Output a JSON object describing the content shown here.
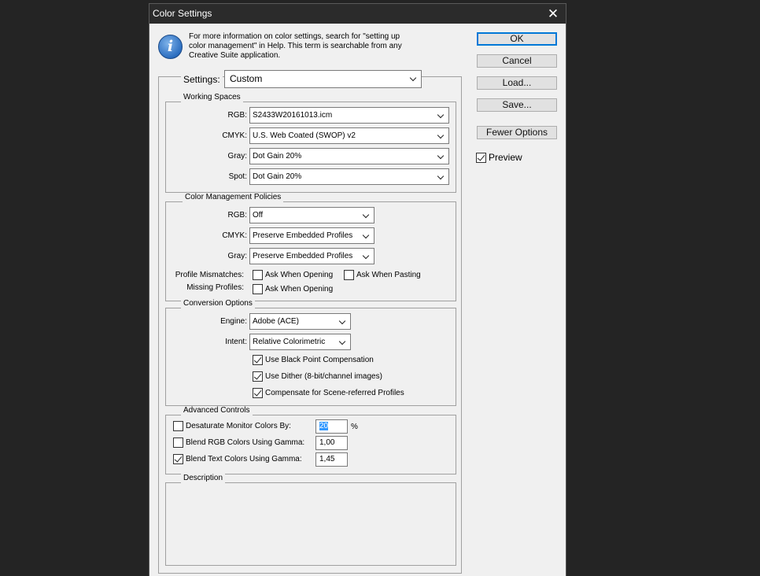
{
  "dialog": {
    "title": "Color Settings",
    "close_glyph": "✕",
    "info_glyph": "i",
    "info_lines": [
      "For more information on color settings, search for \"setting up",
      "color management\" in Help. This term is searchable from any",
      "Creative Suite application."
    ]
  },
  "buttons": {
    "ok": "OK",
    "cancel": "Cancel",
    "load": "Load...",
    "save": "Save...",
    "fewer_options": "Fewer Options",
    "preview": "Preview",
    "preview_checked": true
  },
  "settings": {
    "label": "Settings:",
    "value": "Custom"
  },
  "working_spaces": {
    "title": "Working Spaces",
    "rgb_label": "RGB:",
    "rgb": "S2433W20161013.icm",
    "cmyk_label": "CMYK:",
    "cmyk": "U.S. Web Coated (SWOP) v2",
    "gray_label": "Gray:",
    "gray": "Dot Gain 20%",
    "spot_label": "Spot:",
    "spot": "Dot Gain 20%"
  },
  "policies": {
    "title": "Color Management Policies",
    "rgb_label": "RGB:",
    "rgb": "Off",
    "cmyk_label": "CMYK:",
    "cmyk": "Preserve Embedded Profiles",
    "gray_label": "Gray:",
    "gray": "Preserve Embedded Profiles",
    "mismatch_label": "Profile Mismatches:",
    "ask_opening": "Ask When Opening",
    "ask_pasting": "Ask When Pasting",
    "missing_label": "Missing Profiles:",
    "missing_ask_opening": "Ask When Opening"
  },
  "conversion": {
    "title": "Conversion Options",
    "engine_label": "Engine:",
    "engine": "Adobe (ACE)",
    "intent_label": "Intent:",
    "intent": "Relative Colorimetric",
    "black_point": "Use Black Point Compensation",
    "dither": "Use Dither (8-bit/channel images)",
    "scene_referred": "Compensate for Scene-referred Profiles"
  },
  "advanced": {
    "title": "Advanced Controls",
    "desaturate": "Desaturate Monitor Colors By:",
    "desaturate_value": "20",
    "percent": "%",
    "blend_rgb": "Blend RGB Colors Using Gamma:",
    "blend_rgb_value": "1,00",
    "blend_text": "Blend Text Colors Using Gamma:",
    "blend_text_value": "1,45"
  },
  "description": {
    "title": "Description"
  }
}
